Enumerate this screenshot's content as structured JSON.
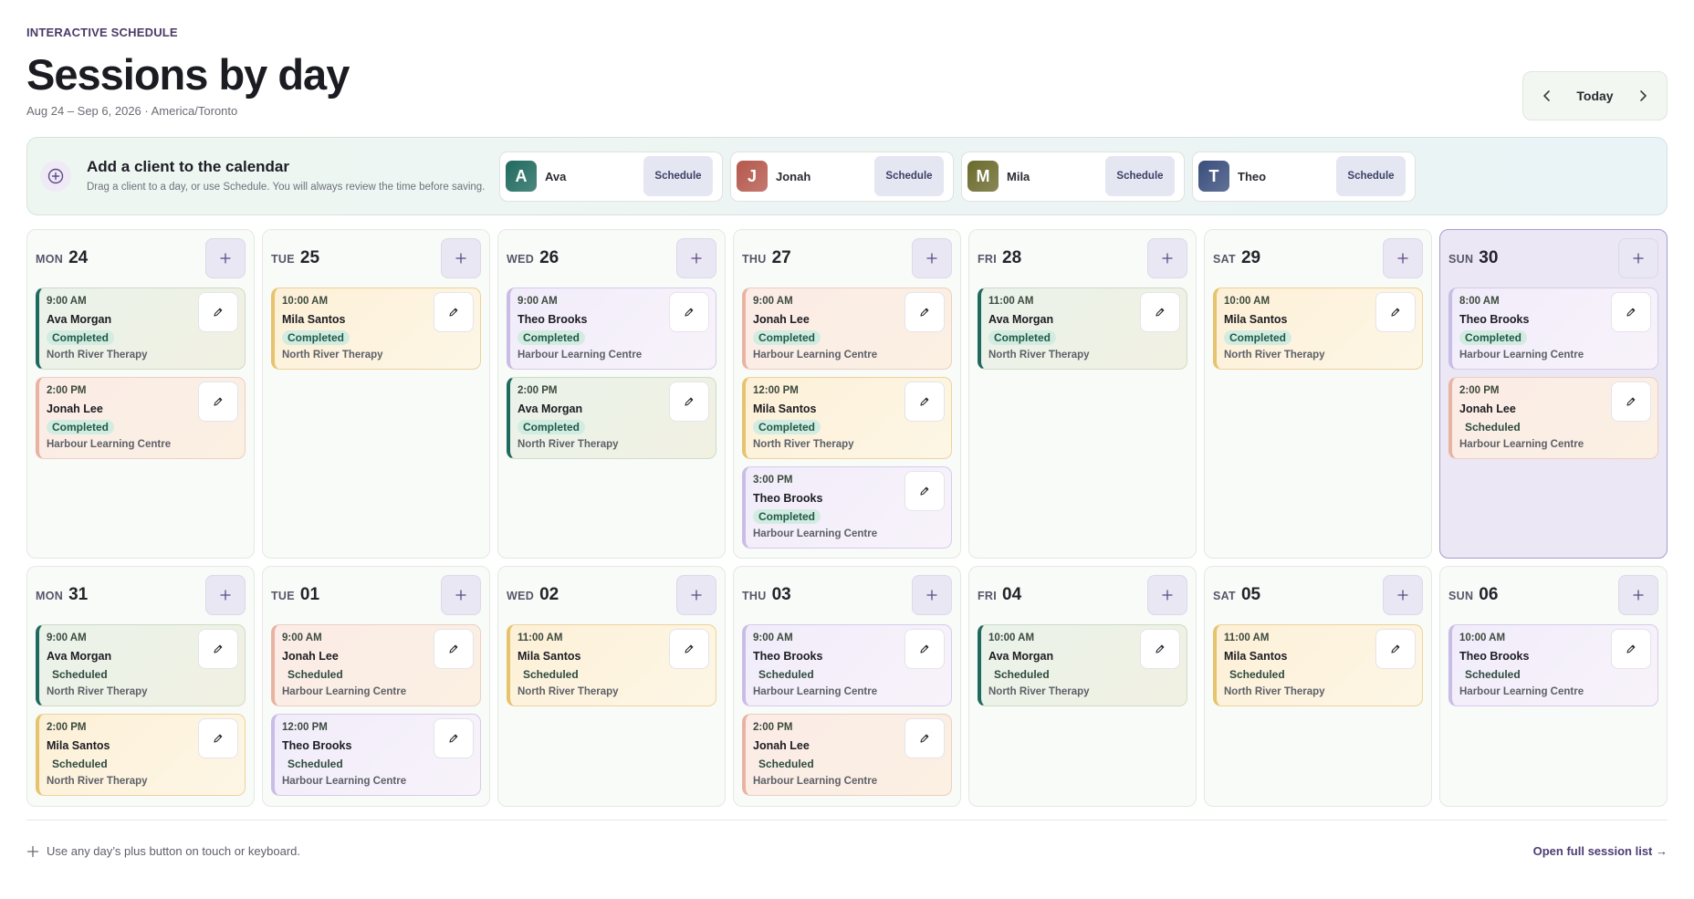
{
  "header": {
    "eyebrow": "INTERACTIVE SCHEDULE",
    "title": "Sessions by day",
    "subtitle": "Aug 24 – Sep 6, 2026 · America/Toronto",
    "today_label": "Today"
  },
  "add_panel": {
    "title": "Add a client to the calendar",
    "description": "Drag a client to a day, or use Schedule. You will always review the time before saving.",
    "schedule_label": "Schedule",
    "clients": [
      {
        "initial": "A",
        "name": "Ava",
        "color": "#1f6a5f"
      },
      {
        "initial": "J",
        "name": "Jonah",
        "color": "#b5584c"
      },
      {
        "initial": "M",
        "name": "Mila",
        "color": "#6b6a2c"
      },
      {
        "initial": "T",
        "name": "Theo",
        "color": "#3a4e7c"
      }
    ]
  },
  "weeks": [
    [
      {
        "dow": "MON",
        "num": "24",
        "sessions": [
          {
            "client": "ava",
            "time": "9:00 AM",
            "name": "Ava Morgan",
            "status": "Completed",
            "location": "North River Therapy"
          },
          {
            "client": "jonah",
            "time": "2:00 PM",
            "name": "Jonah Lee",
            "status": "Completed",
            "location": "Harbour Learning Centre"
          }
        ]
      },
      {
        "dow": "TUE",
        "num": "25",
        "sessions": [
          {
            "client": "mila",
            "time": "10:00 AM",
            "name": "Mila Santos",
            "status": "Completed",
            "location": "North River Therapy"
          }
        ]
      },
      {
        "dow": "WED",
        "num": "26",
        "sessions": [
          {
            "client": "theo",
            "time": "9:00 AM",
            "name": "Theo Brooks",
            "status": "Completed",
            "location": "Harbour Learning Centre"
          },
          {
            "client": "ava",
            "time": "2:00 PM",
            "name": "Ava Morgan",
            "status": "Completed",
            "location": "North River Therapy"
          }
        ]
      },
      {
        "dow": "THU",
        "num": "27",
        "sessions": [
          {
            "client": "jonah",
            "time": "9:00 AM",
            "name": "Jonah Lee",
            "status": "Completed",
            "location": "Harbour Learning Centre"
          },
          {
            "client": "mila",
            "time": "12:00 PM",
            "name": "Mila Santos",
            "status": "Completed",
            "location": "North River Therapy"
          },
          {
            "client": "theo",
            "time": "3:00 PM",
            "name": "Theo Brooks",
            "status": "Completed",
            "location": "Harbour Learning Centre"
          }
        ]
      },
      {
        "dow": "FRI",
        "num": "28",
        "sessions": [
          {
            "client": "ava",
            "time": "11:00 AM",
            "name": "Ava Morgan",
            "status": "Completed",
            "location": "North River Therapy"
          }
        ]
      },
      {
        "dow": "SAT",
        "num": "29",
        "sessions": [
          {
            "client": "mila",
            "time": "10:00 AM",
            "name": "Mila Santos",
            "status": "Completed",
            "location": "North River Therapy"
          }
        ]
      },
      {
        "dow": "SUN",
        "num": "30",
        "today": true,
        "sessions": [
          {
            "client": "theo",
            "time": "8:00 AM",
            "name": "Theo Brooks",
            "status": "Completed",
            "location": "Harbour Learning Centre"
          },
          {
            "client": "jonah",
            "time": "2:00 PM",
            "name": "Jonah Lee",
            "status": "Scheduled",
            "location": "Harbour Learning Centre"
          }
        ]
      }
    ],
    [
      {
        "dow": "MON",
        "num": "31",
        "sessions": [
          {
            "client": "ava",
            "time": "9:00 AM",
            "name": "Ava Morgan",
            "status": "Scheduled",
            "location": "North River Therapy"
          },
          {
            "client": "mila",
            "time": "2:00 PM",
            "name": "Mila Santos",
            "status": "Scheduled",
            "location": "North River Therapy"
          }
        ]
      },
      {
        "dow": "TUE",
        "num": "01",
        "sessions": [
          {
            "client": "jonah",
            "time": "9:00 AM",
            "name": "Jonah Lee",
            "status": "Scheduled",
            "location": "Harbour Learning Centre"
          },
          {
            "client": "theo",
            "time": "12:00 PM",
            "name": "Theo Brooks",
            "status": "Scheduled",
            "location": "Harbour Learning Centre"
          }
        ]
      },
      {
        "dow": "WED",
        "num": "02",
        "sessions": [
          {
            "client": "mila",
            "time": "11:00 AM",
            "name": "Mila Santos",
            "status": "Scheduled",
            "location": "North River Therapy"
          }
        ]
      },
      {
        "dow": "THU",
        "num": "03",
        "sessions": [
          {
            "client": "theo",
            "time": "9:00 AM",
            "name": "Theo Brooks",
            "status": "Scheduled",
            "location": "Harbour Learning Centre"
          },
          {
            "client": "jonah",
            "time": "2:00 PM",
            "name": "Jonah Lee",
            "status": "Scheduled",
            "location": "Harbour Learning Centre"
          }
        ]
      },
      {
        "dow": "FRI",
        "num": "04",
        "sessions": [
          {
            "client": "ava",
            "time": "10:00 AM",
            "name": "Ava Morgan",
            "status": "Scheduled",
            "location": "North River Therapy"
          }
        ]
      },
      {
        "dow": "SAT",
        "num": "05",
        "sessions": [
          {
            "client": "mila",
            "time": "11:00 AM",
            "name": "Mila Santos",
            "status": "Scheduled",
            "location": "North River Therapy"
          }
        ]
      },
      {
        "dow": "SUN",
        "num": "06",
        "sessions": [
          {
            "client": "theo",
            "time": "10:00 AM",
            "name": "Theo Brooks",
            "status": "Scheduled",
            "location": "Harbour Learning Centre"
          }
        ]
      }
    ]
  ],
  "footer": {
    "hint": "Use any day’s plus button on touch or keyboard.",
    "link": "Open full session list →"
  }
}
